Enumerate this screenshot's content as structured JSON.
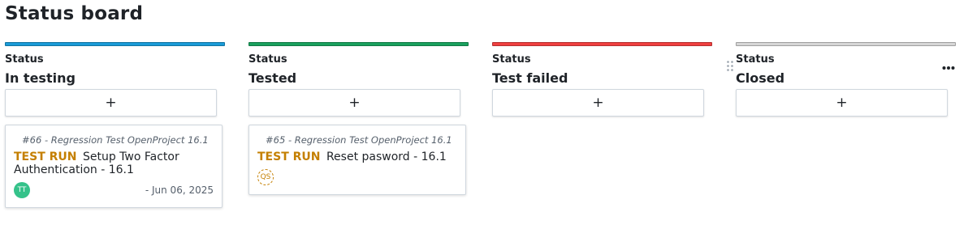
{
  "page": {
    "title": "Status board"
  },
  "columns": [
    {
      "caption": "Status",
      "value": "In testing",
      "color": "#1a9bd7",
      "add_label": "+"
    },
    {
      "caption": "Status",
      "value": "Tested",
      "color": "#1aa15e",
      "add_label": "+"
    },
    {
      "caption": "Status",
      "value": "Test failed",
      "color": "#f04040",
      "add_label": "+"
    },
    {
      "caption": "Status",
      "value": "Closed",
      "color": "#d6d6d6",
      "add_label": "+"
    }
  ],
  "cards": [
    {
      "id": "#66",
      "project": "- Regression Test OpenProject 16.1",
      "type": "TEST RUN",
      "subject": "Setup Two Factor Authentication - 16.1",
      "avatar": "TT",
      "date": "- Jun 06, 2025"
    },
    {
      "id": "#65",
      "project": "- Regression Test OpenProject 16.1",
      "type": "TEST RUN",
      "subject": "Reset pasword - 16.1",
      "avatar": "QS",
      "date": ""
    }
  ],
  "icons": {
    "drag": "drag-handle-icon",
    "menu": "more-options-icon"
  },
  "colors": {
    "type_accent": "#c47f00",
    "avatar_green": "#35c28a"
  }
}
